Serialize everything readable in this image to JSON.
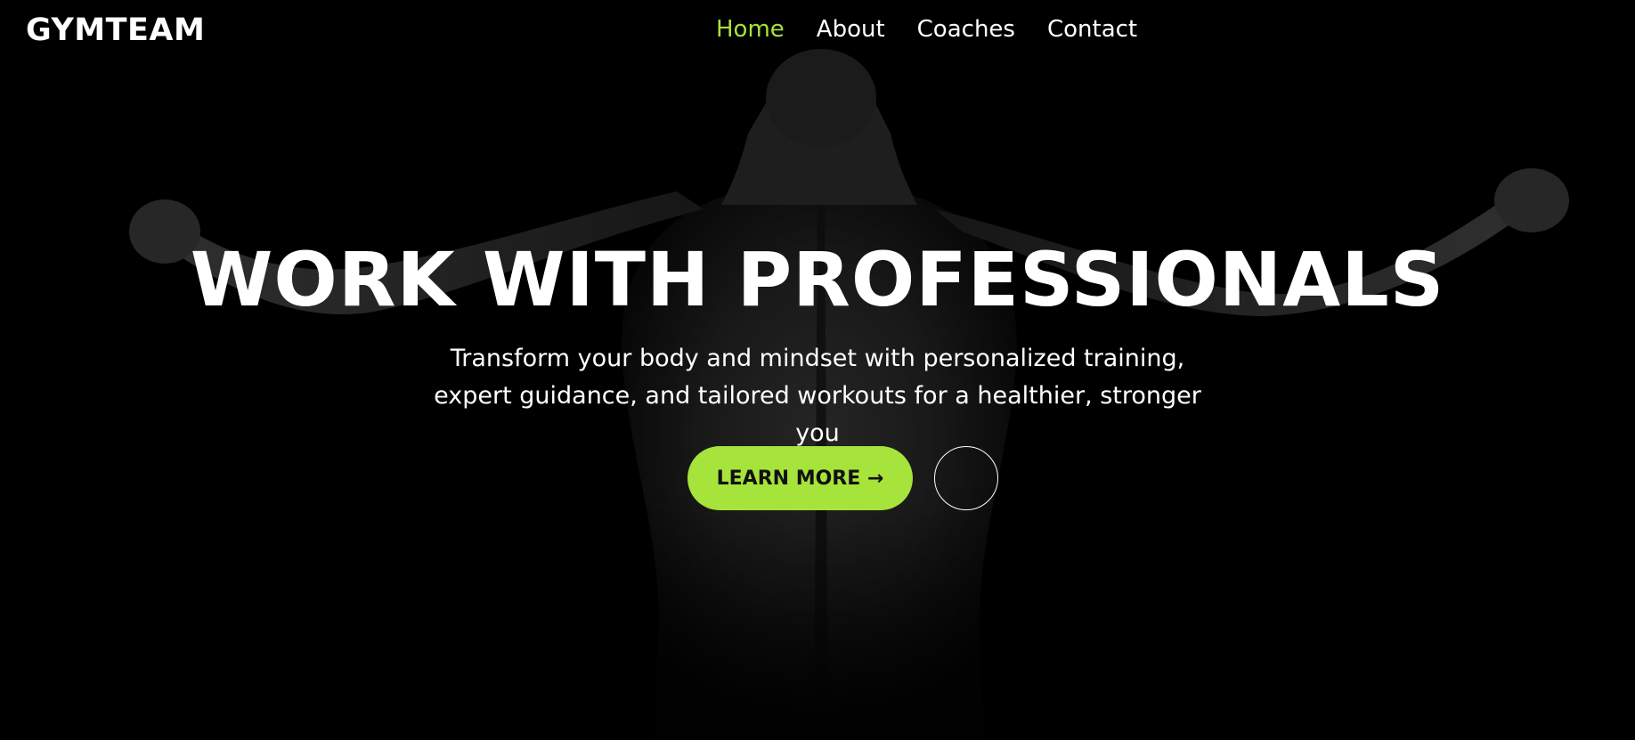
{
  "brand": {
    "name": "GYMTEAM"
  },
  "nav": {
    "items": [
      {
        "label": "Home",
        "active": true
      },
      {
        "label": "About",
        "active": false
      },
      {
        "label": "Coaches",
        "active": false
      },
      {
        "label": "Contact",
        "active": false
      }
    ]
  },
  "hero": {
    "title": "WORK WITH PROFESSIONALS",
    "subtitle": "Transform your body and mindset with personalized training, expert guidance, and tailored workouts for a healthier, stronger you",
    "primary_button": "LEARN MORE →",
    "secondary_button_icon": "circle-icon",
    "background_image": "athlete-back-arms-raised"
  },
  "colors": {
    "accent": "#a6e33b",
    "background": "#000000",
    "text": "#ffffff"
  }
}
